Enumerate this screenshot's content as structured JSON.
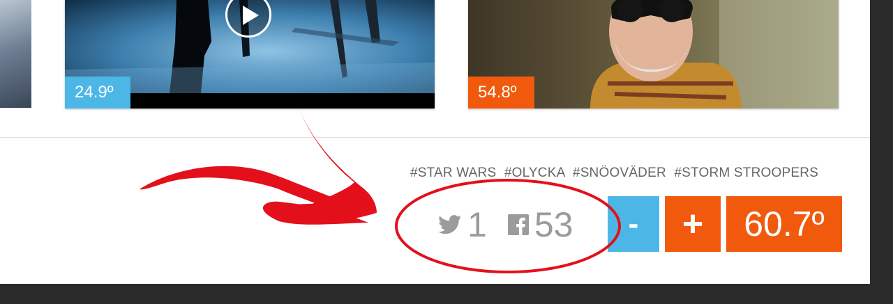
{
  "cards": [
    {
      "temperature": "24.9º",
      "badge_color": "#4cb7e6",
      "has_video": true,
      "play_icon": "play-icon"
    },
    {
      "temperature": "54.8º",
      "badge_color": "#f15a0c",
      "has_video": false
    }
  ],
  "tags": [
    "#STAR WARS",
    "#OLYCKA",
    "#SNÖOVÄDER",
    "#STORM STROOPERS"
  ],
  "share": {
    "twitter_icon": "twitter-icon",
    "twitter_count": "1",
    "facebook_icon": "facebook-icon",
    "facebook_count": "53"
  },
  "vote": {
    "minus_label": "-",
    "plus_label": "+",
    "score": "60.7º",
    "minus_color": "#4cb7e6",
    "plus_color": "#f15a0c"
  },
  "annotation_color": "#e3101b"
}
